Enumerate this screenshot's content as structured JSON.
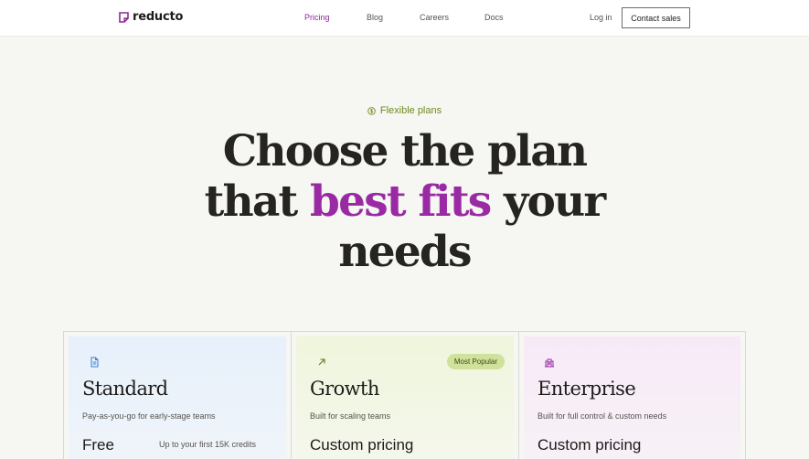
{
  "brand": {
    "name": "reducto",
    "accent": "#8e2a9a"
  },
  "nav": {
    "links": [
      {
        "label": "Pricing",
        "active": true
      },
      {
        "label": "Blog",
        "active": false
      },
      {
        "label": "Careers",
        "active": false
      },
      {
        "label": "Docs",
        "active": false
      }
    ],
    "login_label": "Log in",
    "contact_label": "Contact sales"
  },
  "hero": {
    "badge": "Flexible plans",
    "badge_icon": "dollar-circle-icon",
    "title_part1": "Choose the plan",
    "title_part2": "that ",
    "title_accent": "best fits",
    "title_part3": " your",
    "title_part4": "needs"
  },
  "plans": [
    {
      "icon": "document-icon",
      "name": "Standard",
      "description": "Pay-as-you-go for early-stage teams",
      "price": "Free",
      "note": "Up to your first 15K credits"
    },
    {
      "icon": "arrow-up-right-icon",
      "name": "Growth",
      "badge": "Most Popular",
      "description": "Built for scaling teams",
      "price": "Custom pricing"
    },
    {
      "icon": "building-icon",
      "name": "Enterprise",
      "description": "Built for full control & custom needs",
      "price": "Custom pricing"
    }
  ]
}
